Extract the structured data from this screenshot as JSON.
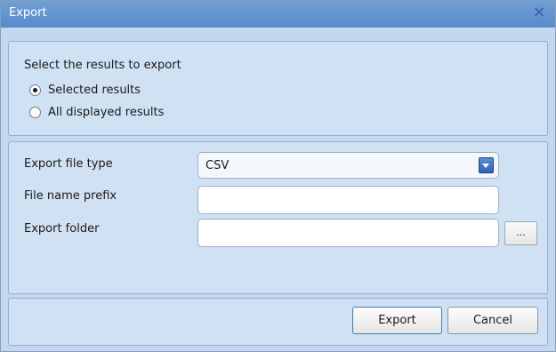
{
  "window": {
    "title": "Export"
  },
  "selection": {
    "prompt": "Select the results to export",
    "options": [
      {
        "label": "Selected results",
        "checked": true
      },
      {
        "label": "All displayed results",
        "checked": false
      }
    ]
  },
  "fields": {
    "file_type": {
      "label": "Export file type",
      "value": "CSV"
    },
    "prefix": {
      "label": "File name prefix",
      "value": ""
    },
    "folder": {
      "label": "Export folder",
      "value": "",
      "browse_label": "..."
    }
  },
  "buttons": {
    "export": "Export",
    "cancel": "Cancel"
  },
  "colors": {
    "titlebar": "#5a8bca",
    "dialog_bg": "#c3d8ef",
    "panel_bg": "#d1e1f4"
  }
}
